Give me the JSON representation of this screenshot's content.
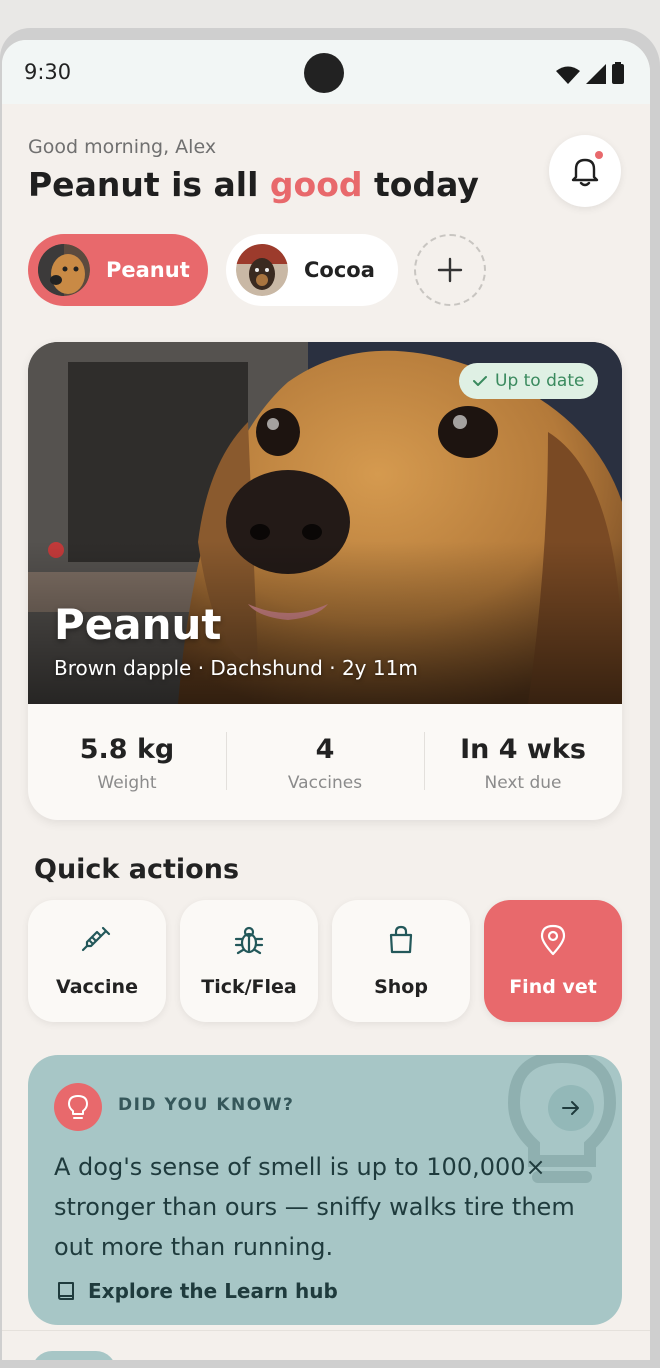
{
  "status_bar": {
    "time": "9:30"
  },
  "header": {
    "greeting": "Good morning, Alex",
    "headline_prefix": "Peanut is all ",
    "headline_accent": "good",
    "headline_suffix": " today"
  },
  "pets": [
    {
      "label": "Peanut",
      "selected": true
    },
    {
      "label": "Cocoa",
      "selected": false
    }
  ],
  "pet_card": {
    "badge": "Up to date",
    "name": "Peanut",
    "subtitle": "Brown dapple · Dachshund · 2y 11m",
    "stats": [
      {
        "value": "5.8 kg",
        "caption": "Weight"
      },
      {
        "value": "4",
        "caption": "Vaccines"
      },
      {
        "value": "In 4 wks",
        "caption": "Next due"
      }
    ]
  },
  "quick_actions": {
    "title": "Quick actions",
    "items": [
      {
        "label": "Vaccine",
        "icon": "syringe-icon"
      },
      {
        "label": "Tick/Flea",
        "icon": "bug-icon"
      },
      {
        "label": "Shop",
        "icon": "shopping-bag-icon"
      },
      {
        "label": "Find vet",
        "icon": "map-pin-icon"
      }
    ]
  },
  "tip": {
    "label": "DID YOU KNOW?",
    "text": "A dog's sense of smell is up to 100,000× stronger than ours — sniffy walks tire them out more than running.",
    "link": "Explore the Learn hub"
  },
  "colors": {
    "accent": "#e8696c",
    "background": "#f4f0ec",
    "tip_background": "#a7c6c6",
    "badge_background": "#dff0e4",
    "badge_text": "#3a8a5e"
  }
}
